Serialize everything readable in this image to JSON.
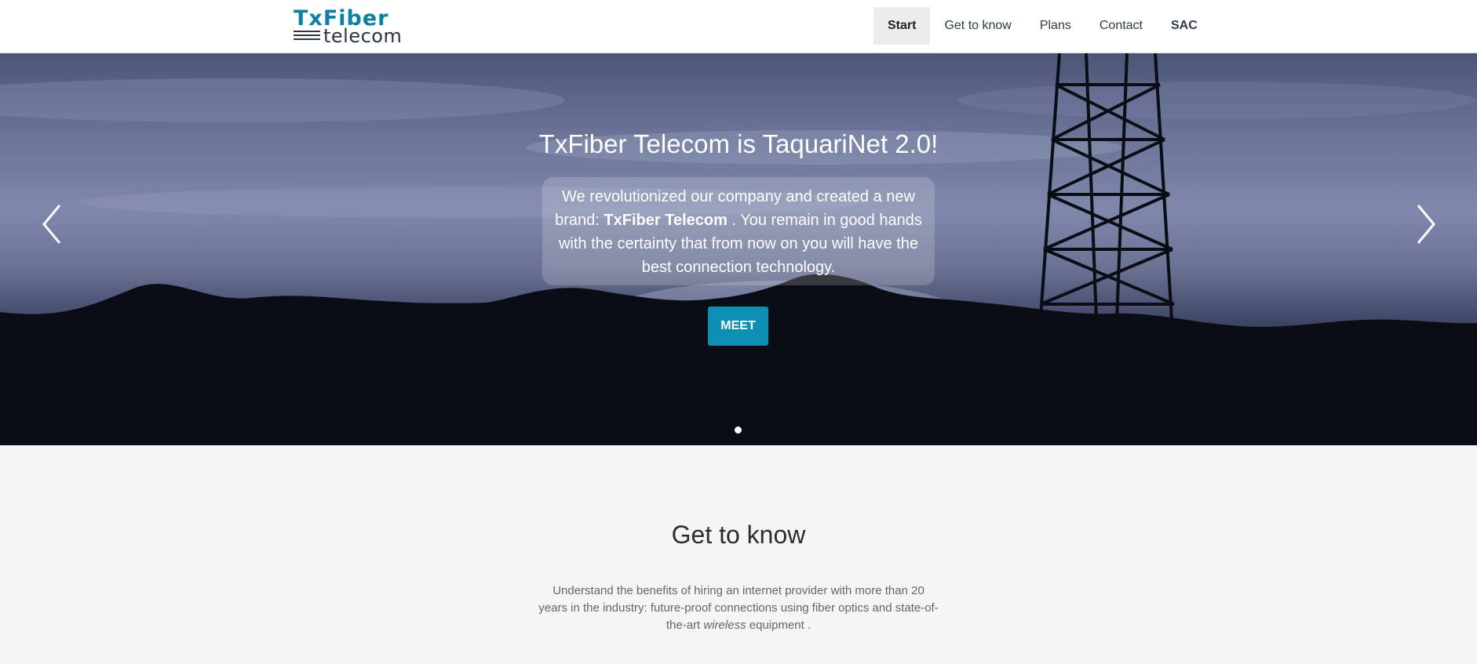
{
  "header": {
    "logo": {
      "brand": "TxFiber",
      "sub": "telecom"
    },
    "nav": [
      {
        "label": "Start"
      },
      {
        "label": "Get to know"
      },
      {
        "label": "Plans"
      },
      {
        "label": "Contact"
      },
      {
        "label": "SAC"
      }
    ]
  },
  "hero": {
    "title": "TxFiber Telecom is TaquariNet 2.0!",
    "text_before": "We revolutionized our company and created a new brand:",
    "text_brand": "TxFiber Telecom",
    "text_after": ". You remain in good hands with the certainty that from now on you will have the best connection technology.",
    "button": "MEET",
    "prev_icon": "chevron-left-icon",
    "next_icon": "chevron-right-icon"
  },
  "section": {
    "title": "Get to know",
    "text_before": "Understand the benefits of hiring an internet provider with more than 20 years in the industry: future-proof connections using fiber optics and state-of-the-art",
    "text_italic": "wireless",
    "text_after": "equipment ."
  },
  "colors": {
    "accent": "#0d8fb3",
    "brand": "#0e7fa4",
    "nav_active_bg": "#ececec"
  }
}
